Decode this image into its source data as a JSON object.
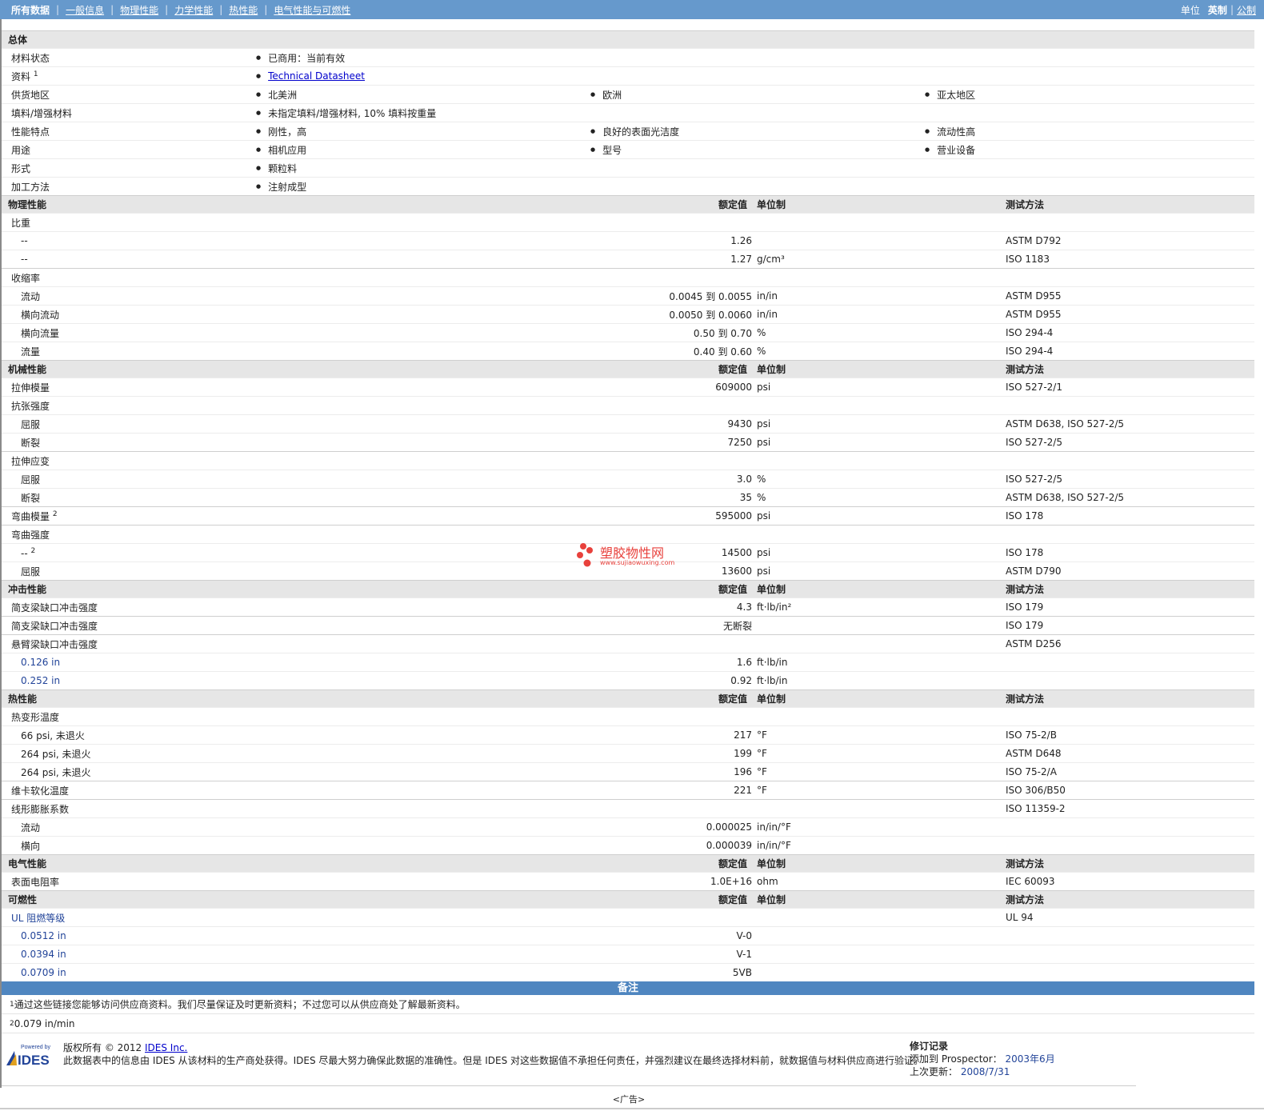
{
  "nav": {
    "items": [
      "所有数据",
      "一般信息",
      "物理性能",
      "力学性能",
      "热性能",
      "电气性能与可燃性"
    ],
    "units_label": "单位",
    "unit_english": "英制",
    "unit_metric": "公制"
  },
  "general": {
    "title": "总体",
    "rows": [
      {
        "label": "材料状态",
        "cols": [
          "已商用：当前有效"
        ]
      },
      {
        "label": "资料",
        "sup": "1",
        "link": "Technical Datasheet"
      },
      {
        "label": "供货地区",
        "cols": [
          "北美洲",
          "欧洲",
          "亚太地区"
        ]
      },
      {
        "label": "填料/增强材料",
        "cols": [
          "未指定填料/增强材料, 10% 填料按重量"
        ]
      },
      {
        "label": "性能特点",
        "cols": [
          "刚性，高",
          "良好的表面光洁度",
          "流动性高"
        ]
      },
      {
        "label": "用途",
        "cols": [
          "相机应用",
          "型号",
          "营业设备"
        ]
      },
      {
        "label": "形式",
        "cols": [
          "颗粒料"
        ]
      },
      {
        "label": "加工方法",
        "cols": [
          "注射成型"
        ]
      }
    ]
  },
  "headers": {
    "nominal": "额定值",
    "unit": "单位制",
    "method": "测试方法"
  },
  "physical": {
    "title": "物理性能",
    "rows": [
      {
        "label": "比重",
        "indent": false
      },
      {
        "label": "--",
        "indent": true,
        "value": "1.26",
        "unit": "",
        "method": "ASTM D792"
      },
      {
        "label": "--",
        "indent": true,
        "value": "1.27",
        "unit": "g/cm³",
        "method": "ISO 1183"
      },
      {
        "label": "收缩率",
        "indent": false,
        "group": true
      },
      {
        "label": "流动",
        "indent": true,
        "value": "0.0045 到  0.0055",
        "unit": "in/in",
        "method": "ASTM D955"
      },
      {
        "label": "横向流动",
        "indent": true,
        "value": "0.0050 到  0.0060",
        "unit": "in/in",
        "method": "ASTM D955"
      },
      {
        "label": "横向流量",
        "indent": true,
        "value": "0.50 到  0.70",
        "unit": "%",
        "method": "ISO 294-4"
      },
      {
        "label": "流量",
        "indent": true,
        "value": "0.40 到  0.60",
        "unit": "%",
        "method": "ISO 294-4"
      }
    ]
  },
  "mechanical": {
    "title": "机械性能",
    "rows": [
      {
        "label": "拉伸模量",
        "indent": false,
        "value": "609000",
        "unit": "psi",
        "method": "ISO 527-2/1"
      },
      {
        "label": "抗张强度",
        "indent": false
      },
      {
        "label": "屈服",
        "indent": true,
        "value": "9430",
        "unit": "psi",
        "method": "ASTM D638, ISO 527-2/5"
      },
      {
        "label": "断裂",
        "indent": true,
        "value": "7250",
        "unit": "psi",
        "method": "ISO 527-2/5"
      },
      {
        "label": "拉伸应变",
        "indent": false,
        "group": true
      },
      {
        "label": "屈服",
        "indent": true,
        "value": "3.0",
        "unit": "%",
        "method": "ISO 527-2/5"
      },
      {
        "label": "断裂",
        "indent": true,
        "value": "35",
        "unit": "%",
        "method": "ASTM D638, ISO 527-2/5"
      },
      {
        "label": "弯曲模量",
        "sup": "2",
        "indent": false,
        "group": true,
        "value": "595000",
        "unit": "psi",
        "method": "ISO 178"
      },
      {
        "label": "弯曲强度",
        "indent": false,
        "group": true
      },
      {
        "label": "--",
        "sup": "2",
        "indent": true,
        "value": "14500",
        "unit": "psi",
        "method": "ISO 178"
      },
      {
        "label": "屈服",
        "indent": true,
        "value": "13600",
        "unit": "psi",
        "method": "ASTM D790"
      }
    ]
  },
  "impact": {
    "title": "冲击性能",
    "rows": [
      {
        "label": "简支梁缺口冲击强度",
        "indent": false,
        "value": "4.3",
        "unit": "ft·lb/in²",
        "method": "ISO 179"
      },
      {
        "label": "简支梁缺口冲击强度",
        "indent": false,
        "group": true,
        "value": "无断裂",
        "unit": "",
        "method": "ISO 179"
      },
      {
        "label": "悬臂梁缺口冲击强度",
        "indent": false,
        "group": true,
        "method": "ASTM D256"
      },
      {
        "label": "0.126 in",
        "indent": true,
        "blue": true,
        "value": "1.6",
        "unit": "ft·lb/in"
      },
      {
        "label": "0.252 in",
        "indent": true,
        "blue": true,
        "value": "0.92",
        "unit": "ft·lb/in"
      }
    ]
  },
  "thermal": {
    "title": "热性能",
    "rows": [
      {
        "label": "热变形温度",
        "indent": false
      },
      {
        "label": "66 psi, 未退火",
        "indent": true,
        "value": "217",
        "unit": "°F",
        "method": "ISO 75-2/B"
      },
      {
        "label": "264 psi, 未退火",
        "indent": true,
        "value": "199",
        "unit": "°F",
        "method": "ASTM D648"
      },
      {
        "label": "264 psi, 未退火",
        "indent": true,
        "value": "196",
        "unit": "°F",
        "method": "ISO 75-2/A"
      },
      {
        "label": "维卡软化温度",
        "indent": false,
        "group": true,
        "value": "221",
        "unit": "°F",
        "method": "ISO 306/B50"
      },
      {
        "label": "线形膨胀系数",
        "indent": false,
        "group": true,
        "method": "ISO 11359-2"
      },
      {
        "label": "流动",
        "indent": true,
        "value": "0.000025",
        "unit": "in/in/°F"
      },
      {
        "label": "横向",
        "indent": true,
        "value": "0.000039",
        "unit": "in/in/°F"
      }
    ]
  },
  "electrical": {
    "title": "电气性能",
    "rows": [
      {
        "label": "表面电阻率",
        "indent": false,
        "value": "1.0E+16",
        "unit": "ohm",
        "method": "IEC 60093"
      }
    ]
  },
  "flammability": {
    "title": "可燃性",
    "rows": [
      {
        "label": "UL 阻燃等级",
        "indent": false,
        "blue": true,
        "method": "UL 94"
      },
      {
        "label": "0.0512 in",
        "indent": true,
        "blue": true,
        "value": "V-0"
      },
      {
        "label": "0.0394 in",
        "indent": true,
        "blue": true,
        "value": "V-1"
      },
      {
        "label": "0.0709 in",
        "indent": true,
        "blue": true,
        "value": "5VB"
      }
    ]
  },
  "notes": {
    "title": "备注",
    "items": [
      {
        "sup": "1",
        "text": "通过这些链接您能够访问供应商资料。我们尽量保证及时更新资料；不过您可以从供应商处了解最新资料。"
      },
      {
        "sup": "2",
        "text": "0.079 in/min"
      }
    ]
  },
  "watermark": {
    "name": "塑胶物性网",
    "url": "www.sujiaowuxing.com"
  },
  "footer": {
    "powered_by": "Powered by",
    "logo_text": "IDES",
    "copyright_prefix": "版权所有  © 2012",
    "copyright_link": "IDES Inc.",
    "disclaimer": "此数据表中的信息由 IDES 从该材料的生产商处获得。IDES 尽最大努力确保此数据的准确性。但是 IDES 对这些数据值不承担任何责任，并强烈建议在最终选择材料前，就数据值与材料供应商进行验证。",
    "rev_title": "修订记录",
    "added_label": "添加到 Prospector：",
    "added_value": "2003年6月",
    "updated_label": "上次更新：",
    "updated_value": "2008/7/31",
    "ad": "<广告>"
  }
}
